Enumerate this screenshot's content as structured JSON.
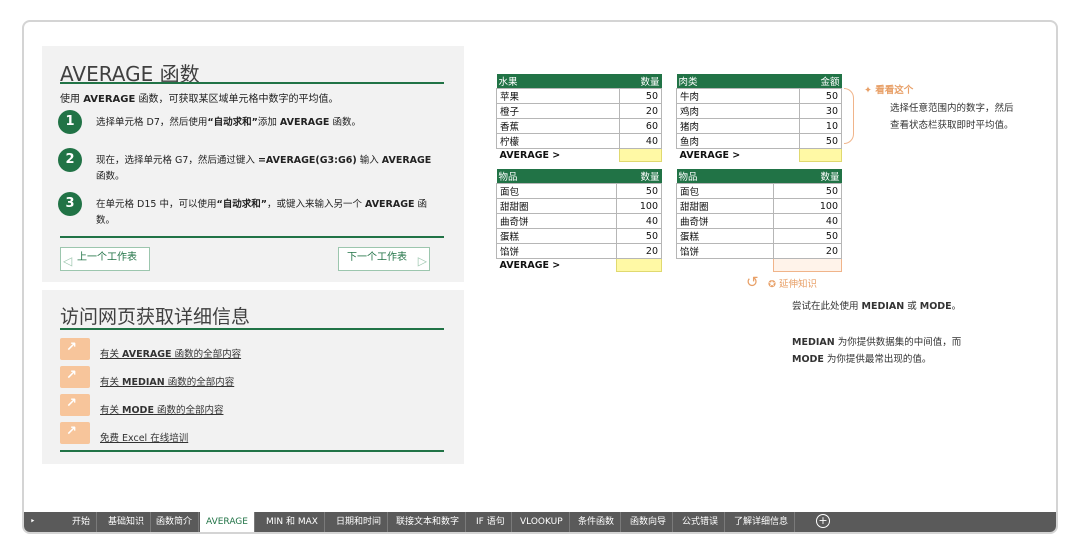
{
  "left_top": {
    "title": "AVERAGE 函数",
    "intro_prefix": "使用 ",
    "intro_bold": "AVERAGE",
    "intro_suffix": " 函数，可获取某区域单元格中数字的平均值。",
    "steps": [
      {
        "num": "1",
        "text_a": "选择单元格 D7，然后使用",
        "text_b": "“自动求和”",
        "text_c": "添加 ",
        "text_d": "AVERAGE",
        "text_e": " 函数。"
      },
      {
        "num": "2",
        "text_a": "现在，选择单元格 G7，然后通过键入 ",
        "text_b": "=AVERAGE(G3:G6)",
        "text_c": " 输入 ",
        "text_d": "AVERAGE",
        "text_e": " 函数。"
      },
      {
        "num": "3",
        "text_a": "在单元格 D15 中，可以使用",
        "text_b": "“自动求和”",
        "text_c": "，或键入来输入另一个 ",
        "text_d": "AVERAGE",
        "text_e": " 函数。"
      }
    ],
    "prev": "上一个工作表",
    "next": "下一个工作表"
  },
  "left_bottom": {
    "title": "访问网页获取详细信息",
    "links": [
      {
        "a": "有关 ",
        "b": "AVERAGE",
        "c": " 函数的全部内容"
      },
      {
        "a": "有关 ",
        "b": "MEDIAN",
        "c": " 函数的全部内容"
      },
      {
        "a": "有关 ",
        "b": "MODE",
        "c": " 函数的全部内容"
      },
      {
        "a": "免费 Excel 在线培训",
        "b": "",
        "c": ""
      }
    ]
  },
  "tables": {
    "fruit": {
      "h1": "水果",
      "h2": "数量",
      "rows": [
        [
          "苹果",
          "50"
        ],
        [
          "橙子",
          "20"
        ],
        [
          "香蕉",
          "60"
        ],
        [
          "柠檬",
          "40"
        ]
      ],
      "avg": "AVERAGE >"
    },
    "meat": {
      "h1": "肉类",
      "h2": "金额",
      "rows": [
        [
          "牛肉",
          "50"
        ],
        [
          "鸡肉",
          "30"
        ],
        [
          "猪肉",
          "10"
        ],
        [
          "鱼肉",
          "50"
        ]
      ],
      "avg": "AVERAGE >"
    },
    "goods1": {
      "h1": "物品",
      "h2": "数量",
      "rows": [
        [
          "面包",
          "50"
        ],
        [
          "甜甜圈",
          "100"
        ],
        [
          "曲奇饼",
          "40"
        ],
        [
          "蛋糕",
          "50"
        ],
        [
          "馅饼",
          "20"
        ]
      ],
      "avg": "AVERAGE >"
    },
    "goods2": {
      "h1": "物品",
      "h2": "数量",
      "rows": [
        [
          "面包",
          "50"
        ],
        [
          "甜甜圈",
          "100"
        ],
        [
          "曲奇饼",
          "40"
        ],
        [
          "蛋糕",
          "50"
        ],
        [
          "馅饼",
          "20"
        ]
      ]
    }
  },
  "notes": {
    "look_title": "看看这个",
    "look_text_1": "选择任意范围内的数字，然后",
    "look_text_2": "查看状态栏获取即时平均值。",
    "ext_title": "延伸知识",
    "ext_line_a": "尝试在此处使用 ",
    "ext_line_b": "MEDIAN",
    "ext_line_c": " 或 ",
    "ext_line_d": "MODE",
    "ext_line_e": "。",
    "median_a": "MEDIAN",
    "median_b": " 为你提供数据集的中间值，而",
    "mode_a": "MODE",
    "mode_b": " 为你提供最常出现的值。"
  },
  "tabbar": {
    "tabs": [
      "开始",
      "基础知识",
      "函数简介",
      "AVERAGE",
      "MIN 和 MAX",
      "日期和时间",
      "联接文本和数字",
      "IF 语句",
      "VLOOKUP",
      "条件函数",
      "函数向导",
      "公式错误",
      "了解详细信息"
    ],
    "active": "AVERAGE",
    "more": "‣",
    "add": "+"
  },
  "colors": {
    "accent": "#217346",
    "orange": "#f0b48a",
    "yellow": "#fff9a5"
  }
}
